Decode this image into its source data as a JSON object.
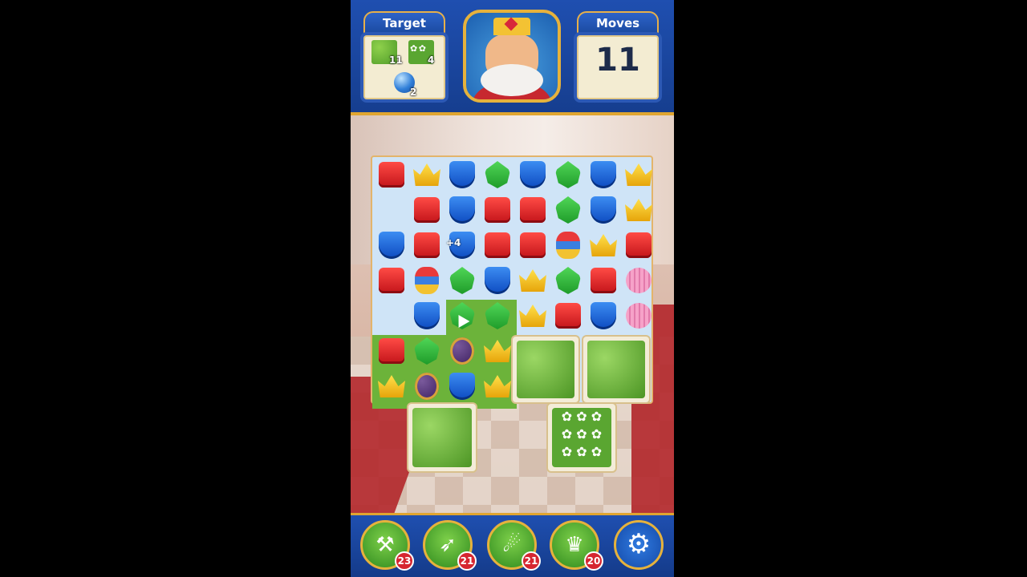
{
  "header": {
    "target_label": "Target",
    "moves_label": "Moves",
    "moves_value": "11",
    "targets": [
      {
        "icon": "hedge-tile-icon",
        "count": "11"
      },
      {
        "icon": "flower-tile-icon",
        "count": "4"
      },
      {
        "icon": "blue-ball-icon",
        "count": "2"
      }
    ]
  },
  "board": {
    "combo_text": "+4",
    "rows": [
      [
        "red",
        "crown",
        "blue",
        "green",
        "blue",
        "green",
        "blue",
        "crown"
      ],
      [
        "",
        "red",
        "blue",
        "red",
        "red",
        "green",
        "blue",
        "crown"
      ],
      [
        "blue",
        "red",
        "blue",
        "red",
        "red",
        "bomb",
        "crown",
        "red"
      ],
      [
        "red",
        "bomb",
        "green",
        "blue",
        "crown",
        "green",
        "red",
        "pink"
      ],
      [
        "",
        "blue",
        "green",
        "green",
        "crown",
        "red",
        "blue",
        "pink"
      ],
      [
        "red",
        "green",
        "egg",
        "crown",
        "",
        "",
        "",
        ""
      ],
      [
        "crown",
        "egg",
        "blue",
        "crown",
        "",
        "",
        "",
        ""
      ]
    ]
  },
  "boosters": [
    {
      "name": "hammer",
      "count": "23",
      "glyph": "⚒"
    },
    {
      "name": "arrow",
      "count": "21",
      "glyph": "➶"
    },
    {
      "name": "cannon",
      "count": "21",
      "glyph": "☄"
    },
    {
      "name": "jester",
      "count": "20",
      "glyph": "♛"
    }
  ],
  "colors": {
    "header": "#1f4fb0",
    "gold": "#e0a530",
    "grass": "#6cb33a"
  }
}
